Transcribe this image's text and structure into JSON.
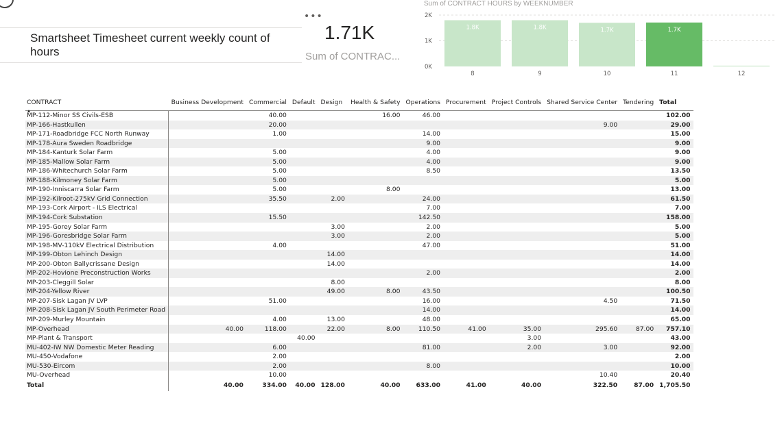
{
  "card": {
    "title": "Smartsheet Timesheet current weekly count of hours",
    "kpi_value": "1.71K",
    "kpi_label": "Sum of CONTRAC...",
    "more_icon": "more-options-icon"
  },
  "colors": {
    "bar_light": "#c8e6c9",
    "bar_highlight": "#66bb66",
    "bar_label_light": "#ffffff",
    "grid": "#e1dfdd",
    "axis_text": "#605e5c"
  },
  "chart_data": {
    "type": "bar",
    "title": "Sum of CONTRACT HOURS by WEEKNUMBER",
    "categories": [
      "8",
      "9",
      "10",
      "11",
      "12"
    ],
    "values": [
      1800,
      1800,
      1700,
      1710,
      30
    ],
    "data_labels": [
      "1.8K",
      "1.8K",
      "1.7K",
      "1.7K",
      ""
    ],
    "highlighted": "11",
    "y_ticks": [
      "0K",
      "1K",
      "2K"
    ],
    "ylim": [
      0,
      2000
    ],
    "grid": true
  },
  "table": {
    "headers": [
      "CONTRACT",
      "Business Development",
      "Commercial",
      "Default",
      "Design",
      "Health & Safety",
      "Operations",
      "Procurement",
      "Project Controls",
      "Shared Service Center",
      "Tendering",
      "Total"
    ],
    "rows": [
      [
        "MP-112-Minor SS Civils-ESB",
        "",
        "40.00",
        "",
        "",
        "16.00",
        "46.00",
        "",
        "",
        "",
        "",
        "102.00"
      ],
      [
        "MP-166-Hastkullen",
        "",
        "20.00",
        "",
        "",
        "",
        "",
        "",
        "",
        "9.00",
        "",
        "29.00"
      ],
      [
        "MP-171-Roadbridge FCC North Runway",
        "",
        "1.00",
        "",
        "",
        "",
        "14.00",
        "",
        "",
        "",
        "",
        "15.00"
      ],
      [
        "MP-178-Aura Sweden Roadbridge",
        "",
        "",
        "",
        "",
        "",
        "9.00",
        "",
        "",
        "",
        "",
        "9.00"
      ],
      [
        "MP-184-Kanturk Solar Farm",
        "",
        "5.00",
        "",
        "",
        "",
        "4.00",
        "",
        "",
        "",
        "",
        "9.00"
      ],
      [
        "MP-185-Mallow Solar Farm",
        "",
        "5.00",
        "",
        "",
        "",
        "4.00",
        "",
        "",
        "",
        "",
        "9.00"
      ],
      [
        "MP-186-Whitechurch Solar Farm",
        "",
        "5.00",
        "",
        "",
        "",
        "8.50",
        "",
        "",
        "",
        "",
        "13.50"
      ],
      [
        "MP-188-Kilmoney Solar Farm",
        "",
        "5.00",
        "",
        "",
        "",
        "",
        "",
        "",
        "",
        "",
        "5.00"
      ],
      [
        "MP-190-Inniscarra Solar Farm",
        "",
        "5.00",
        "",
        "",
        "8.00",
        "",
        "",
        "",
        "",
        "",
        "13.00"
      ],
      [
        "MP-192-Kilroot-275kV Grid Connection",
        "",
        "35.50",
        "",
        "2.00",
        "",
        "24.00",
        "",
        "",
        "",
        "",
        "61.50"
      ],
      [
        "MP-193-Cork Airport - ILS Electrical",
        "",
        "",
        "",
        "",
        "",
        "7.00",
        "",
        "",
        "",
        "",
        "7.00"
      ],
      [
        "MP-194-Cork Substation",
        "",
        "15.50",
        "",
        "",
        "",
        "142.50",
        "",
        "",
        "",
        "",
        "158.00"
      ],
      [
        "MP-195-Gorey Solar Farm",
        "",
        "",
        "",
        "3.00",
        "",
        "2.00",
        "",
        "",
        "",
        "",
        "5.00"
      ],
      [
        "MP-196-Goresbridge Solar Farm",
        "",
        "",
        "",
        "3.00",
        "",
        "2.00",
        "",
        "",
        "",
        "",
        "5.00"
      ],
      [
        "MP-198-MV-110kV Electrical Distribution",
        "",
        "4.00",
        "",
        "",
        "",
        "47.00",
        "",
        "",
        "",
        "",
        "51.00"
      ],
      [
        "MP-199-Obton Lehinch Design",
        "",
        "",
        "",
        "14.00",
        "",
        "",
        "",
        "",
        "",
        "",
        "14.00"
      ],
      [
        "MP-200-Obton Ballycrissane Design",
        "",
        "",
        "",
        "14.00",
        "",
        "",
        "",
        "",
        "",
        "",
        "14.00"
      ],
      [
        "MP-202-Hovione Preconstruction Works",
        "",
        "",
        "",
        "",
        "",
        "2.00",
        "",
        "",
        "",
        "",
        "2.00"
      ],
      [
        "MP-203-Cleggill Solar",
        "",
        "",
        "",
        "8.00",
        "",
        "",
        "",
        "",
        "",
        "",
        "8.00"
      ],
      [
        "MP-204-Yellow River",
        "",
        "",
        "",
        "49.00",
        "8.00",
        "43.50",
        "",
        "",
        "",
        "",
        "100.50"
      ],
      [
        "MP-207-Sisk Lagan JV LVP",
        "",
        "51.00",
        "",
        "",
        "",
        "16.00",
        "",
        "",
        "4.50",
        "",
        "71.50"
      ],
      [
        "MP-208-Sisk Lagan JV South Perimeter Road",
        "",
        "",
        "",
        "",
        "",
        "14.00",
        "",
        "",
        "",
        "",
        "14.00"
      ],
      [
        "MP-209-Murley Mountain",
        "",
        "4.00",
        "",
        "13.00",
        "",
        "48.00",
        "",
        "",
        "",
        "",
        "65.00"
      ],
      [
        "MP-Overhead",
        "40.00",
        "118.00",
        "",
        "22.00",
        "8.00",
        "110.50",
        "41.00",
        "35.00",
        "295.60",
        "87.00",
        "757.10"
      ],
      [
        "MP-Plant & Transport",
        "",
        "",
        "40.00",
        "",
        "",
        "",
        "",
        "3.00",
        "",
        "",
        "43.00"
      ],
      [
        "MU-402-IW NW Domestic Meter Reading",
        "",
        "6.00",
        "",
        "",
        "",
        "81.00",
        "",
        "2.00",
        "3.00",
        "",
        "92.00"
      ],
      [
        "MU-450-Vodafone",
        "",
        "2.00",
        "",
        "",
        "",
        "",
        "",
        "",
        "",
        "",
        "2.00"
      ],
      [
        "MU-530-Eircom",
        "",
        "2.00",
        "",
        "",
        "",
        "8.00",
        "",
        "",
        "",
        "",
        "10.00"
      ],
      [
        "MU-Overhead",
        "",
        "10.00",
        "",
        "",
        "",
        "",
        "",
        "",
        "10.40",
        "",
        "20.40"
      ]
    ],
    "total_row": [
      "Total",
      "40.00",
      "334.00",
      "40.00",
      "128.00",
      "40.00",
      "633.00",
      "41.00",
      "40.00",
      "322.50",
      "87.00",
      "1,705.50"
    ]
  }
}
